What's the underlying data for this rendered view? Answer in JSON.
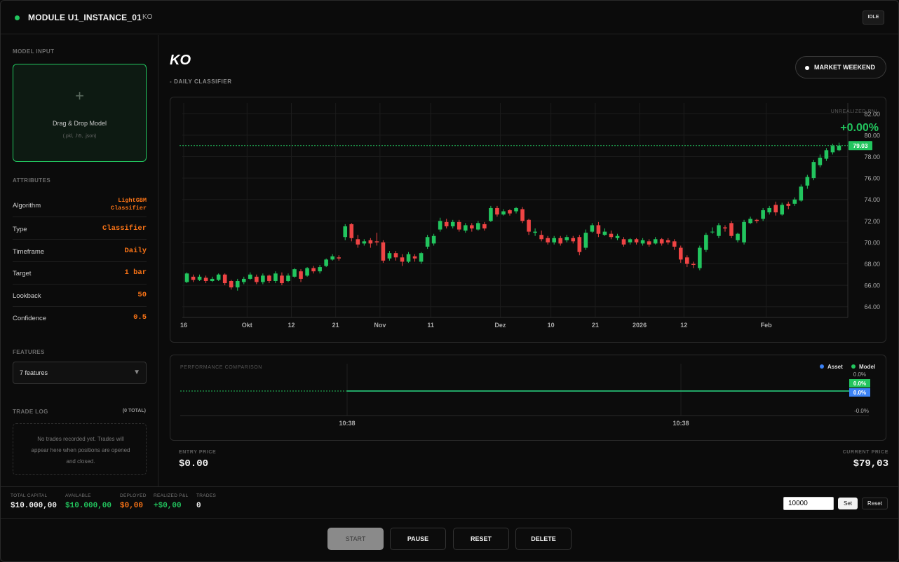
{
  "header": {
    "title": "MODULE U1_INSTANCE_01",
    "ticker": "KO",
    "status": "IDLE",
    "status_color": "#22c55e"
  },
  "sidebar": {
    "model_input": {
      "title": "MODEL INPUT",
      "plus": "+",
      "label": "Drag & Drop Model",
      "hint": "(.pkl, .h5, .json)"
    },
    "attributes": {
      "title": "ATTRIBUTES",
      "rows": [
        {
          "key": "Algorithm",
          "value": "LightGBM Classifier"
        },
        {
          "key": "Type",
          "value": "Classifier"
        },
        {
          "key": "Timeframe",
          "value": "Daily"
        },
        {
          "key": "Target",
          "value": "1 bar"
        },
        {
          "key": "Lookback",
          "value": "50"
        },
        {
          "key": "Confidence",
          "value": "0.5"
        }
      ]
    },
    "features": {
      "title": "FEATURES",
      "selected": "7 features"
    },
    "trade_log": {
      "title": "TRADE LOG",
      "count": "(0 TOTAL)",
      "empty": "No trades recorded yet. Trades will appear here when positions are opened and closed."
    }
  },
  "main": {
    "symbol": "KO",
    "subtitle": "- DAILY CLASSIFIER",
    "market_status": "MARKET WEEKEND",
    "entry_price_label": "ENTRY PRICE",
    "entry_price": "$0.00",
    "current_price_label": "CURRENT PRICE",
    "current_price": "$79,03"
  },
  "chart_data": [
    {
      "type": "candlestick",
      "overlay_label": "UNREALIZED PNL",
      "overlay_value": "+0.00%",
      "last_price_label": "79.03",
      "ylim": [
        63.0,
        83.0
      ],
      "y_ticks": [
        "64.00",
        "66.00",
        "68.00",
        "70.00",
        "72.00",
        "74.00",
        "76.00",
        "78.00",
        "80.00",
        "82.00"
      ],
      "x_ticks": [
        "16",
        "Okt",
        "12",
        "21",
        "Nov",
        "11",
        "Dez",
        "10",
        "21",
        "2026",
        "12",
        "Feb"
      ],
      "candles": [
        [
          66.3,
          67.1,
          67.2,
          66.2
        ],
        [
          66.8,
          66.5,
          67.0,
          66.3
        ],
        [
          66.5,
          66.8,
          67.0,
          66.4
        ],
        [
          66.7,
          66.4,
          66.9,
          66.2
        ],
        [
          66.4,
          66.6,
          66.8,
          66.3
        ],
        [
          66.5,
          67.0,
          67.1,
          66.4
        ],
        [
          67.0,
          66.2,
          67.1,
          66.0
        ],
        [
          66.4,
          65.8,
          66.5,
          65.6
        ],
        [
          65.8,
          66.4,
          66.6,
          65.5
        ],
        [
          66.3,
          66.6,
          66.8,
          66.1
        ],
        [
          66.6,
          67.0,
          67.2,
          66.5
        ],
        [
          66.8,
          66.3,
          67.0,
          66.1
        ],
        [
          66.3,
          66.9,
          67.1,
          66.1
        ],
        [
          66.9,
          66.4,
          67.0,
          66.2
        ],
        [
          66.4,
          67.1,
          67.3,
          66.2
        ],
        [
          66.9,
          66.2,
          67.2,
          66.0
        ],
        [
          66.4,
          66.9,
          67.1,
          66.3
        ],
        [
          66.8,
          67.5,
          67.6,
          66.7
        ],
        [
          67.3,
          66.6,
          67.5,
          66.3
        ],
        [
          66.9,
          67.6,
          67.7,
          66.8
        ],
        [
          67.6,
          67.3,
          67.8,
          67.1
        ],
        [
          67.3,
          67.7,
          67.9,
          67.1
        ],
        [
          67.8,
          68.4,
          68.5,
          67.7
        ],
        [
          68.4,
          68.7,
          68.9,
          68.3
        ],
        [
          68.6,
          68.5,
          68.8,
          68.3
        ],
        [
          70.5,
          71.5,
          71.7,
          70.2
        ],
        [
          71.7,
          70.4,
          71.8,
          70.1
        ],
        [
          70.3,
          69.8,
          70.7,
          69.5
        ],
        [
          69.9,
          70.1,
          70.3,
          69.7
        ],
        [
          70.2,
          69.9,
          70.4,
          69.5
        ],
        [
          70.1,
          70.0,
          70.9,
          69.7
        ],
        [
          70.0,
          68.3,
          70.2,
          68.1
        ],
        [
          68.5,
          69.0,
          69.2,
          68.3
        ],
        [
          69.0,
          68.6,
          69.2,
          68.3
        ],
        [
          68.6,
          68.2,
          68.9,
          67.8
        ],
        [
          68.2,
          68.9,
          69.1,
          68.1
        ],
        [
          68.7,
          68.5,
          68.9,
          68.2
        ],
        [
          68.2,
          69.0,
          69.1,
          68.0
        ],
        [
          69.6,
          70.5,
          70.7,
          69.4
        ],
        [
          69.9,
          70.6,
          70.8,
          69.7
        ],
        [
          71.2,
          72.0,
          72.3,
          71.0
        ],
        [
          71.9,
          71.5,
          72.2,
          71.3
        ],
        [
          71.5,
          71.9,
          72.1,
          71.3
        ],
        [
          71.9,
          71.2,
          72.1,
          71.0
        ],
        [
          71.1,
          71.6,
          71.8,
          70.9
        ],
        [
          71.6,
          71.3,
          71.8,
          71.0
        ],
        [
          71.2,
          71.8,
          72.0,
          71.1
        ],
        [
          71.7,
          71.3,
          71.9,
          71.1
        ],
        [
          72.0,
          73.2,
          73.4,
          71.9
        ],
        [
          73.2,
          72.6,
          73.4,
          72.4
        ],
        [
          72.6,
          72.9,
          73.1,
          72.5
        ],
        [
          73.0,
          72.7,
          73.1,
          72.5
        ],
        [
          72.9,
          73.2,
          73.3,
          72.7
        ],
        [
          73.1,
          72.0,
          73.3,
          71.8
        ],
        [
          72.1,
          71.0,
          72.2,
          70.7
        ],
        [
          70.9,
          71.0,
          71.3,
          70.6
        ],
        [
          70.7,
          70.3,
          71.1,
          70.1
        ],
        [
          70.4,
          70.0,
          70.6,
          69.8
        ],
        [
          70.0,
          70.4,
          70.6,
          69.8
        ],
        [
          70.4,
          69.9,
          70.6,
          69.7
        ],
        [
          70.2,
          70.5,
          70.7,
          70.0
        ],
        [
          70.4,
          70.1,
          70.6,
          69.9
        ],
        [
          70.5,
          69.1,
          70.7,
          68.8
        ],
        [
          69.5,
          70.9,
          71.2,
          69.3
        ],
        [
          71.0,
          71.6,
          71.8,
          70.9
        ],
        [
          71.6,
          70.8,
          71.9,
          70.5
        ],
        [
          70.7,
          71.0,
          71.3,
          70.6
        ],
        [
          70.8,
          70.5,
          71.1,
          70.3
        ],
        [
          70.4,
          70.6,
          70.8,
          70.2
        ],
        [
          70.3,
          69.8,
          70.5,
          69.6
        ],
        [
          70.0,
          70.3,
          70.4,
          69.8
        ],
        [
          70.3,
          70.0,
          70.4,
          69.8
        ],
        [
          69.9,
          70.2,
          70.4,
          69.7
        ],
        [
          70.1,
          69.8,
          70.3,
          69.6
        ],
        [
          69.9,
          70.3,
          70.5,
          69.8
        ],
        [
          70.3,
          69.9,
          70.4,
          69.7
        ],
        [
          70.2,
          70.0,
          70.4,
          69.8
        ],
        [
          70.1,
          69.6,
          70.3,
          69.3
        ],
        [
          69.5,
          68.4,
          69.7,
          68.1
        ],
        [
          68.6,
          68.0,
          68.8,
          67.7
        ],
        [
          68.0,
          67.9,
          68.2,
          67.6
        ],
        [
          67.6,
          69.5,
          69.7,
          67.4
        ],
        [
          69.3,
          70.7,
          70.9,
          69.1
        ],
        [
          71.0,
          71.0,
          71.4,
          70.8
        ],
        [
          70.6,
          71.6,
          71.8,
          70.4
        ],
        [
          71.4,
          71.3,
          71.6,
          71.0
        ],
        [
          71.8,
          70.6,
          72.0,
          70.4
        ],
        [
          70.2,
          70.8,
          70.9,
          70.0
        ],
        [
          70.0,
          71.9,
          72.1,
          69.8
        ],
        [
          71.8,
          72.2,
          72.4,
          71.7
        ],
        [
          72.1,
          72.0,
          72.2,
          71.8
        ],
        [
          72.2,
          73.0,
          73.2,
          72.0
        ],
        [
          72.8,
          73.2,
          73.4,
          72.6
        ],
        [
          73.5,
          72.8,
          73.8,
          72.5
        ],
        [
          72.6,
          73.5,
          73.7,
          72.5
        ],
        [
          73.6,
          73.4,
          73.8,
          73.1
        ],
        [
          73.6,
          74.0,
          74.2,
          73.4
        ],
        [
          73.9,
          75.2,
          75.4,
          73.8
        ],
        [
          75.3,
          76.1,
          76.3,
          75.0
        ],
        [
          76.0,
          77.5,
          77.7,
          75.8
        ],
        [
          77.2,
          77.9,
          78.2,
          77.0
        ],
        [
          77.8,
          78.6,
          78.8,
          77.6
        ],
        [
          78.4,
          79.0,
          79.2,
          78.2
        ],
        [
          78.6,
          79.03,
          79.3,
          78.5
        ]
      ]
    },
    {
      "type": "line",
      "title": "PERFORMANCE COMPARISON",
      "series": [
        {
          "name": "Asset",
          "color": "#3b82f6",
          "last": "0.0%"
        },
        {
          "name": "Model",
          "color": "#22c55e",
          "last": "0.0%"
        }
      ],
      "y_ticks": [
        "0.0%",
        "-0.0%"
      ],
      "x_ticks": [
        "10:38",
        "10:38"
      ]
    }
  ],
  "stats": {
    "total_capital_label": "TOTAL CAPITAL",
    "total_capital": "$10.000,00",
    "available_label": "AVAILABLE",
    "available": "$10.000,00",
    "deployed_label": "DEPLOYED",
    "deployed": "$0,00",
    "realized_label": "REALIZED P&L",
    "realized": "+$0,00",
    "trades_label": "TRADES",
    "trades": "0",
    "capital_input": "10000",
    "set_label": "Set",
    "reset_label": "Reset"
  },
  "controls": {
    "start": "START",
    "pause": "PAUSE",
    "reset": "RESET",
    "delete": "DELETE"
  },
  "colors": {
    "up": "#22c55e",
    "down": "#ef4444",
    "orange": "#f97316"
  }
}
